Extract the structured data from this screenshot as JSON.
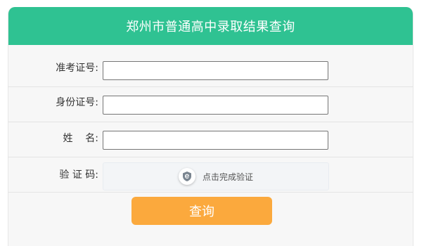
{
  "header": {
    "title": "郑州市普通高中录取结果查询"
  },
  "form": {
    "exam_id_label": "准考证号:",
    "id_card_label": "身份证号:",
    "name_label": "姓    名:",
    "captcha_label": "验 证 码:",
    "captcha_prompt": "点击完成验证",
    "submit_label": "查询"
  },
  "colors": {
    "header_bg": "#2fc292",
    "button_bg": "#fba93d"
  },
  "icons": {
    "captcha": "verify-shield-icon"
  }
}
